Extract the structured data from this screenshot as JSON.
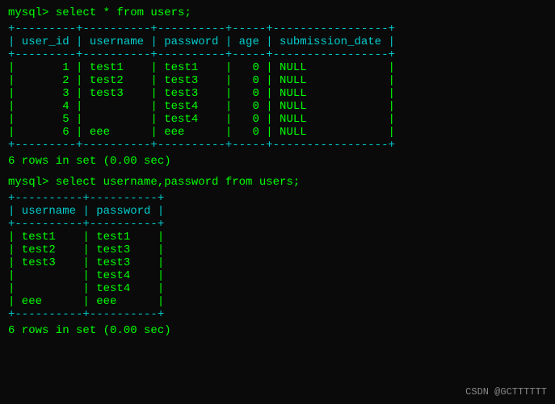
{
  "terminal": {
    "bg": "#0a0a0a",
    "prompt_color": "#ff8c00",
    "text_color": "#00ff00",
    "border_color": "#00cccc"
  },
  "query1": {
    "prompt": "mysql> ",
    "command": "select * from users;",
    "separator_top": "+---------+----------+----------+-----+-----------------+",
    "header": "| user_id | username | password | age | submission_date |",
    "separator_mid": "+---------+----------+----------+-----+-----------------+",
    "rows": [
      "|       1 | test1    | test1    |   0 | NULL            |",
      "|       2 | test2    | test3    |   0 | NULL            |",
      "|       3 | test3    | test3    |   0 | NULL            |",
      "|       4 |          | test4    |   0 | NULL            |",
      "|       5 |          | test4    |   0 | NULL            |",
      "|       6 | eee      | eee      |   0 | NULL            |"
    ],
    "separator_bot": "+---------+----------+----------+-----+-----------------+",
    "result": "6 rows in set (0.00 sec)"
  },
  "query2": {
    "prompt": "mysql> ",
    "command": "select username,password from users;",
    "separator_top": "+----------+----------+",
    "header": "| username | password |",
    "separator_mid": "+----------+----------+",
    "rows": [
      "| test1    | test1    |",
      "| test2    | test3    |",
      "| test3    | test3    |",
      "|          | test4    |",
      "|          | test4    |",
      "| eee      | eee      |"
    ],
    "separator_bot": "+----------+----------+",
    "result": "6 rows in set (0.00 sec)"
  },
  "watermark": "CSDN @GCTTTTTT"
}
